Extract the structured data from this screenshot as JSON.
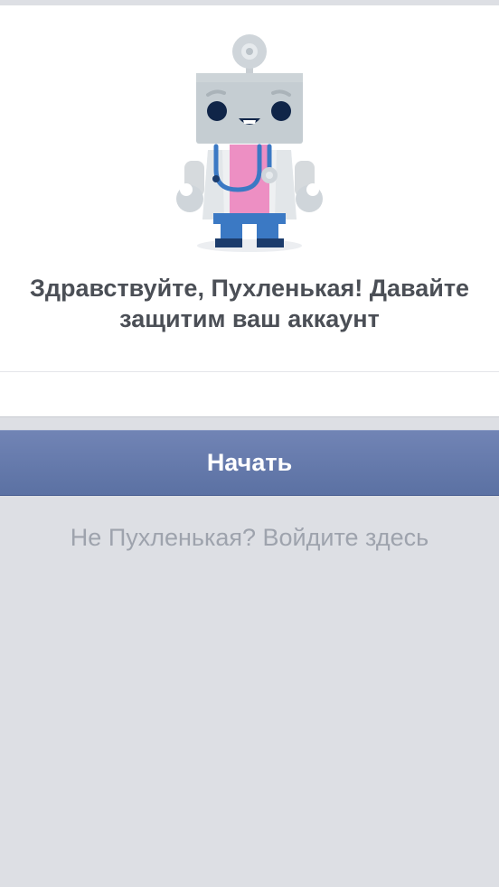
{
  "greeting": {
    "line1": "Здравствуйте, Пухленькая! Давайте",
    "line2": "защитим ваш аккаунт"
  },
  "start_button": {
    "label": "Начать"
  },
  "alt_login": {
    "label": "Не Пухленькая? Войдите здесь"
  },
  "illustration": {
    "icon": "doctor-robot-icon"
  },
  "colors": {
    "background": "#dddfe4",
    "card": "#ffffff",
    "button": "#6478ab",
    "heading": "#4b4f56",
    "muted_link": "#9ea3ad"
  }
}
